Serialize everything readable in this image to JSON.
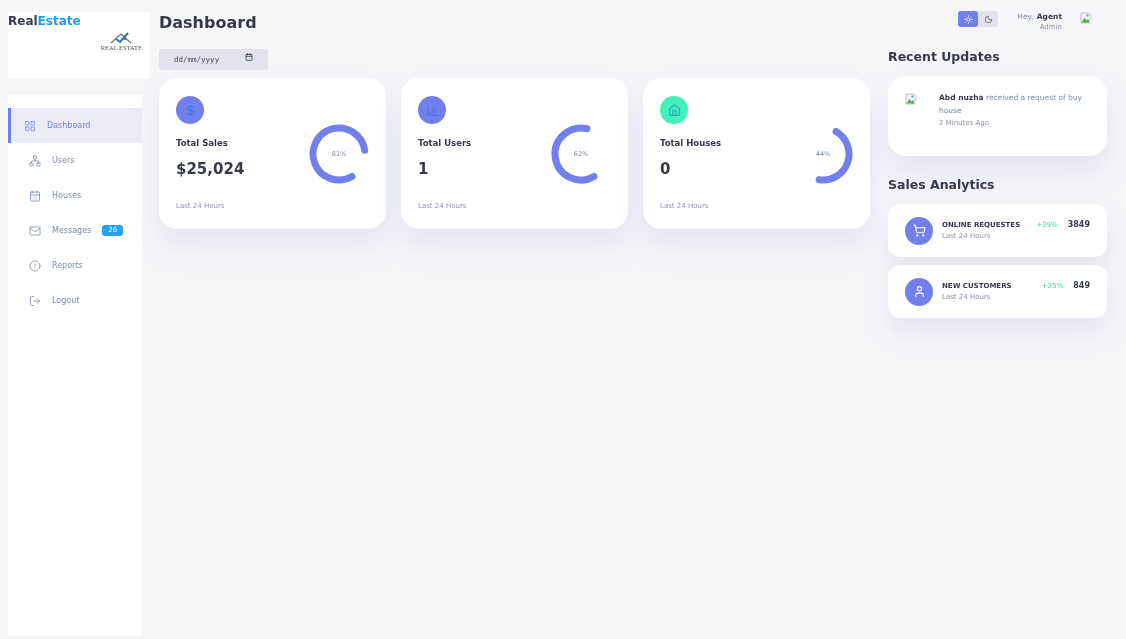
{
  "sidebar": {
    "brand": {
      "primary": "Real",
      "accent": "Estate",
      "logo_caption": "REAL ESTATE"
    },
    "items": [
      {
        "label": "Dashboard",
        "selected": true
      },
      {
        "label": "Users",
        "selected": false
      },
      {
        "label": "Houses",
        "selected": false
      },
      {
        "label": "Messages",
        "selected": false,
        "badge": "26"
      },
      {
        "label": "Reports",
        "selected": false
      },
      {
        "label": "Logout",
        "selected": false
      }
    ]
  },
  "main": {
    "title": "Dashboard",
    "date_field": {
      "placeholder": "dd/mm/yyyy"
    },
    "cards": [
      {
        "title": "Total Sales",
        "value": "$25,024",
        "caption": "Last 24 Hours",
        "level": 0.81,
        "reading": "81%",
        "color": "#7380ec"
      },
      {
        "title": "Total Users",
        "value": "1",
        "caption": "Last 24 Hours",
        "level": 0.62,
        "reading": "62%",
        "color": "#7380ec"
      },
      {
        "title": "Total Houses",
        "value": "0",
        "caption": "Last 24 Hours",
        "level": 0.44,
        "reading": "44%",
        "color": "#41f1b6"
      }
    ]
  },
  "header": {
    "theme_modes": [
      {
        "selected": true
      },
      {
        "selected": false
      }
    ],
    "greeting": "Hey, **Agent**",
    "role": "Admin"
  },
  "recent_updates": {
    "title": "Recent Updates",
    "items": [
      {
        "message": "**Abd nuzha** received a request of buy house",
        "time": "2 Minutes Ago"
      }
    ]
  },
  "sales_analytics": {
    "title": "Sales Analytics",
    "items": [
      {
        "title": "ONLINE REQUESTES",
        "caption": "Last 24 Hours",
        "change": "+39%",
        "value": "3849"
      },
      {
        "title": "NEW CUSTOMERS",
        "caption": "Last 24 Hours",
        "change": "+25%",
        "value": "849"
      }
    ]
  }
}
